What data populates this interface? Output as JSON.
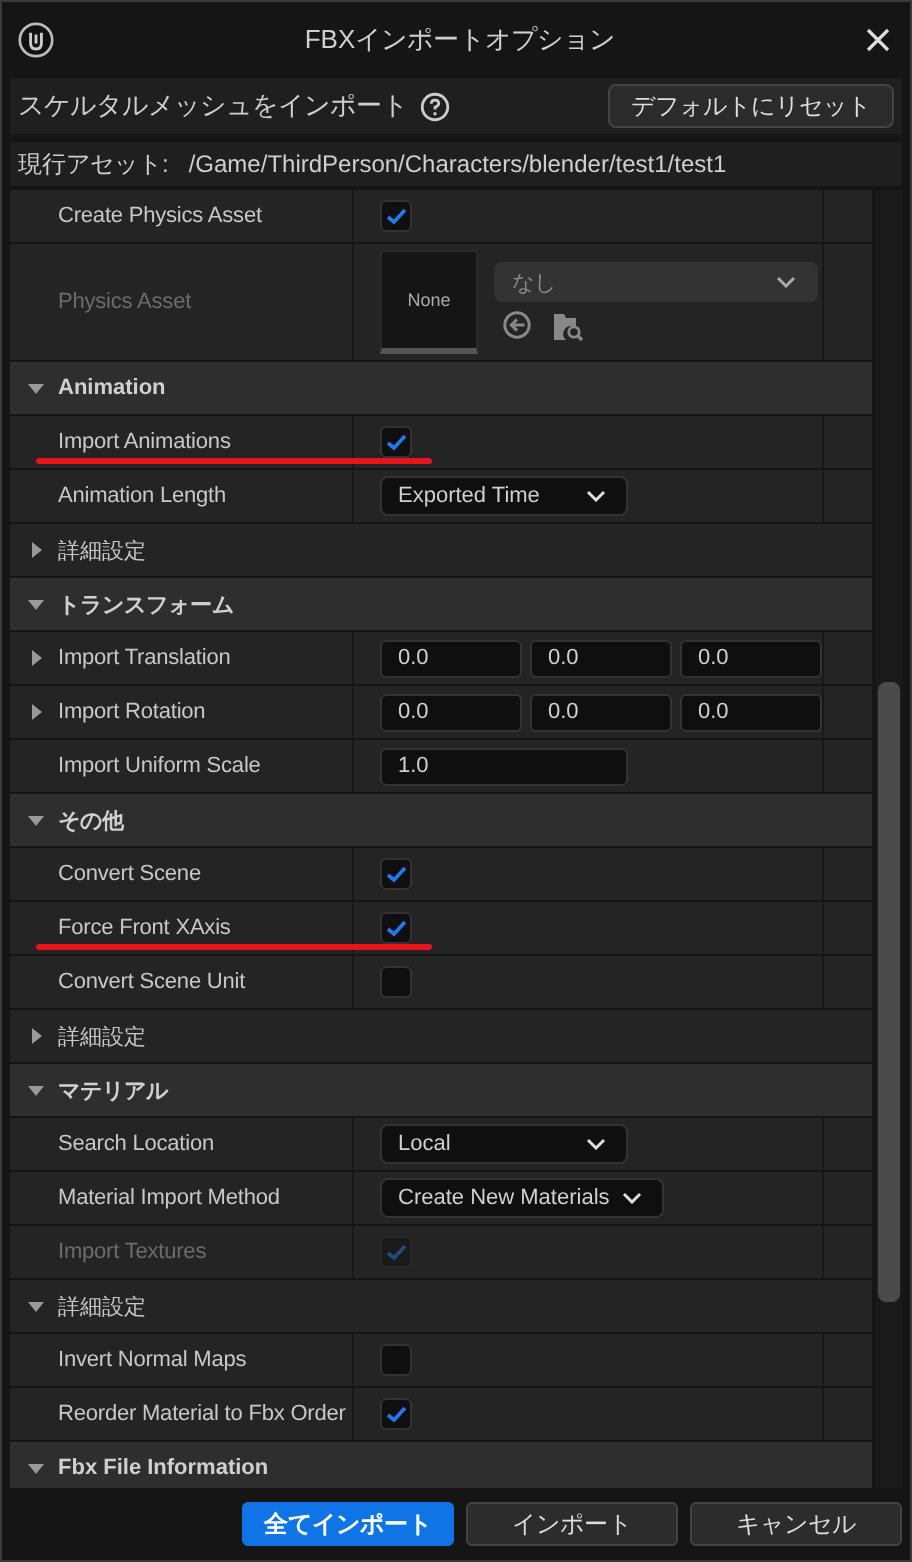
{
  "window": {
    "title": "FBXインポートオプション"
  },
  "header": {
    "title": "スケルタルメッシュをインポート",
    "reset_button": "デフォルトにリセット"
  },
  "current_asset": {
    "label": "現行アセット:",
    "path": "/Game/ThirdPerson/Characters/blender/test1/test1"
  },
  "rows": [
    {
      "kind": "checkbox",
      "label": "Create Physics Asset",
      "checked": true,
      "disabled": false,
      "highlighted": false
    },
    {
      "kind": "asset",
      "label": "Physics Asset",
      "disabled": true,
      "thumb": "None",
      "value": "なし"
    },
    {
      "kind": "category",
      "label": "Animation",
      "expanded": true
    },
    {
      "kind": "checkbox",
      "label": "Import Animations",
      "checked": true,
      "disabled": false,
      "highlighted": true
    },
    {
      "kind": "dropdown",
      "label": "Animation Length",
      "value": "Exported Time"
    },
    {
      "kind": "group",
      "label": "詳細設定",
      "expanded": false
    },
    {
      "kind": "category",
      "label": "トランスフォーム",
      "expanded": true
    },
    {
      "kind": "vector",
      "label": "Import Translation",
      "expanded": false,
      "values": [
        "0.0",
        "0.0",
        "0.0"
      ]
    },
    {
      "kind": "vector",
      "label": "Import Rotation",
      "expanded": false,
      "values": [
        "0.0",
        "0.0",
        "0.0"
      ]
    },
    {
      "kind": "number",
      "label": "Import Uniform Scale",
      "value": "1.0"
    },
    {
      "kind": "category",
      "label": "その他",
      "expanded": true
    },
    {
      "kind": "checkbox",
      "label": "Convert Scene",
      "checked": true,
      "disabled": false,
      "highlighted": false
    },
    {
      "kind": "checkbox",
      "label": "Force Front XAxis",
      "checked": true,
      "disabled": false,
      "highlighted": true
    },
    {
      "kind": "checkbox",
      "label": "Convert Scene Unit",
      "checked": false,
      "disabled": false,
      "highlighted": false
    },
    {
      "kind": "group",
      "label": "詳細設定",
      "expanded": false
    },
    {
      "kind": "category",
      "label": "マテリアル",
      "expanded": true
    },
    {
      "kind": "dropdown",
      "label": "Search Location",
      "value": "Local"
    },
    {
      "kind": "dropdown",
      "label": "Material Import Method",
      "value": "Create New Materials"
    },
    {
      "kind": "checkbox",
      "label": "Import Textures",
      "checked": true,
      "disabled": true,
      "highlighted": false
    },
    {
      "kind": "group",
      "label": "詳細設定",
      "expanded": true
    },
    {
      "kind": "checkbox",
      "label": "Invert Normal Maps",
      "checked": false,
      "disabled": false,
      "highlighted": false
    },
    {
      "kind": "checkbox",
      "label": "Reorder Material to Fbx Order",
      "checked": true,
      "disabled": false,
      "highlighted": false
    },
    {
      "kind": "category",
      "label": "Fbx File Information",
      "expanded": true
    }
  ],
  "buttons": [
    {
      "label": "全てインポート",
      "primary": true
    },
    {
      "label": "インポート",
      "primary": false
    },
    {
      "label": "キャンセル",
      "primary": false
    }
  ]
}
